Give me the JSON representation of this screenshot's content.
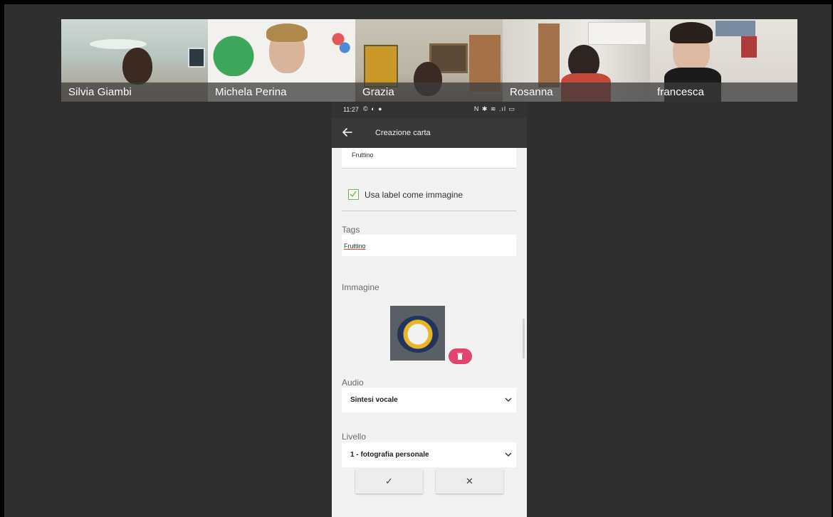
{
  "participants": [
    {
      "name": "Silvia Giambi"
    },
    {
      "name": "Michela Perina"
    },
    {
      "name": "Grazia"
    },
    {
      "name": "Rosanna"
    },
    {
      "name": "francesca"
    }
  ],
  "phone": {
    "status": {
      "time": "11:27",
      "left_icons": "© ◐ ●",
      "right_icons": "N ✱ ≋ .ıl ▭"
    },
    "app_bar": {
      "title": "Creazione carta",
      "back_icon": "arrow-left-icon"
    },
    "label_field": {
      "value": "Fruttino"
    },
    "checkbox": {
      "label": "Usa label come immagine",
      "checked": true
    },
    "tags": {
      "label": "Tags",
      "value": "Fruttino"
    },
    "image": {
      "label": "Immagine",
      "delete_icon": "trash-icon"
    },
    "audio": {
      "label": "Audio",
      "selected": "Sintesi vocale"
    },
    "level": {
      "label": "Livello",
      "selected": "1 - fotografia personale"
    },
    "buttons": {
      "confirm": "✓",
      "cancel": "✕"
    }
  },
  "colors": {
    "accent_green": "#7ab04d",
    "delete_pink": "#e0456e",
    "app_bar": "#393939",
    "stage": "#2f2f2f"
  }
}
